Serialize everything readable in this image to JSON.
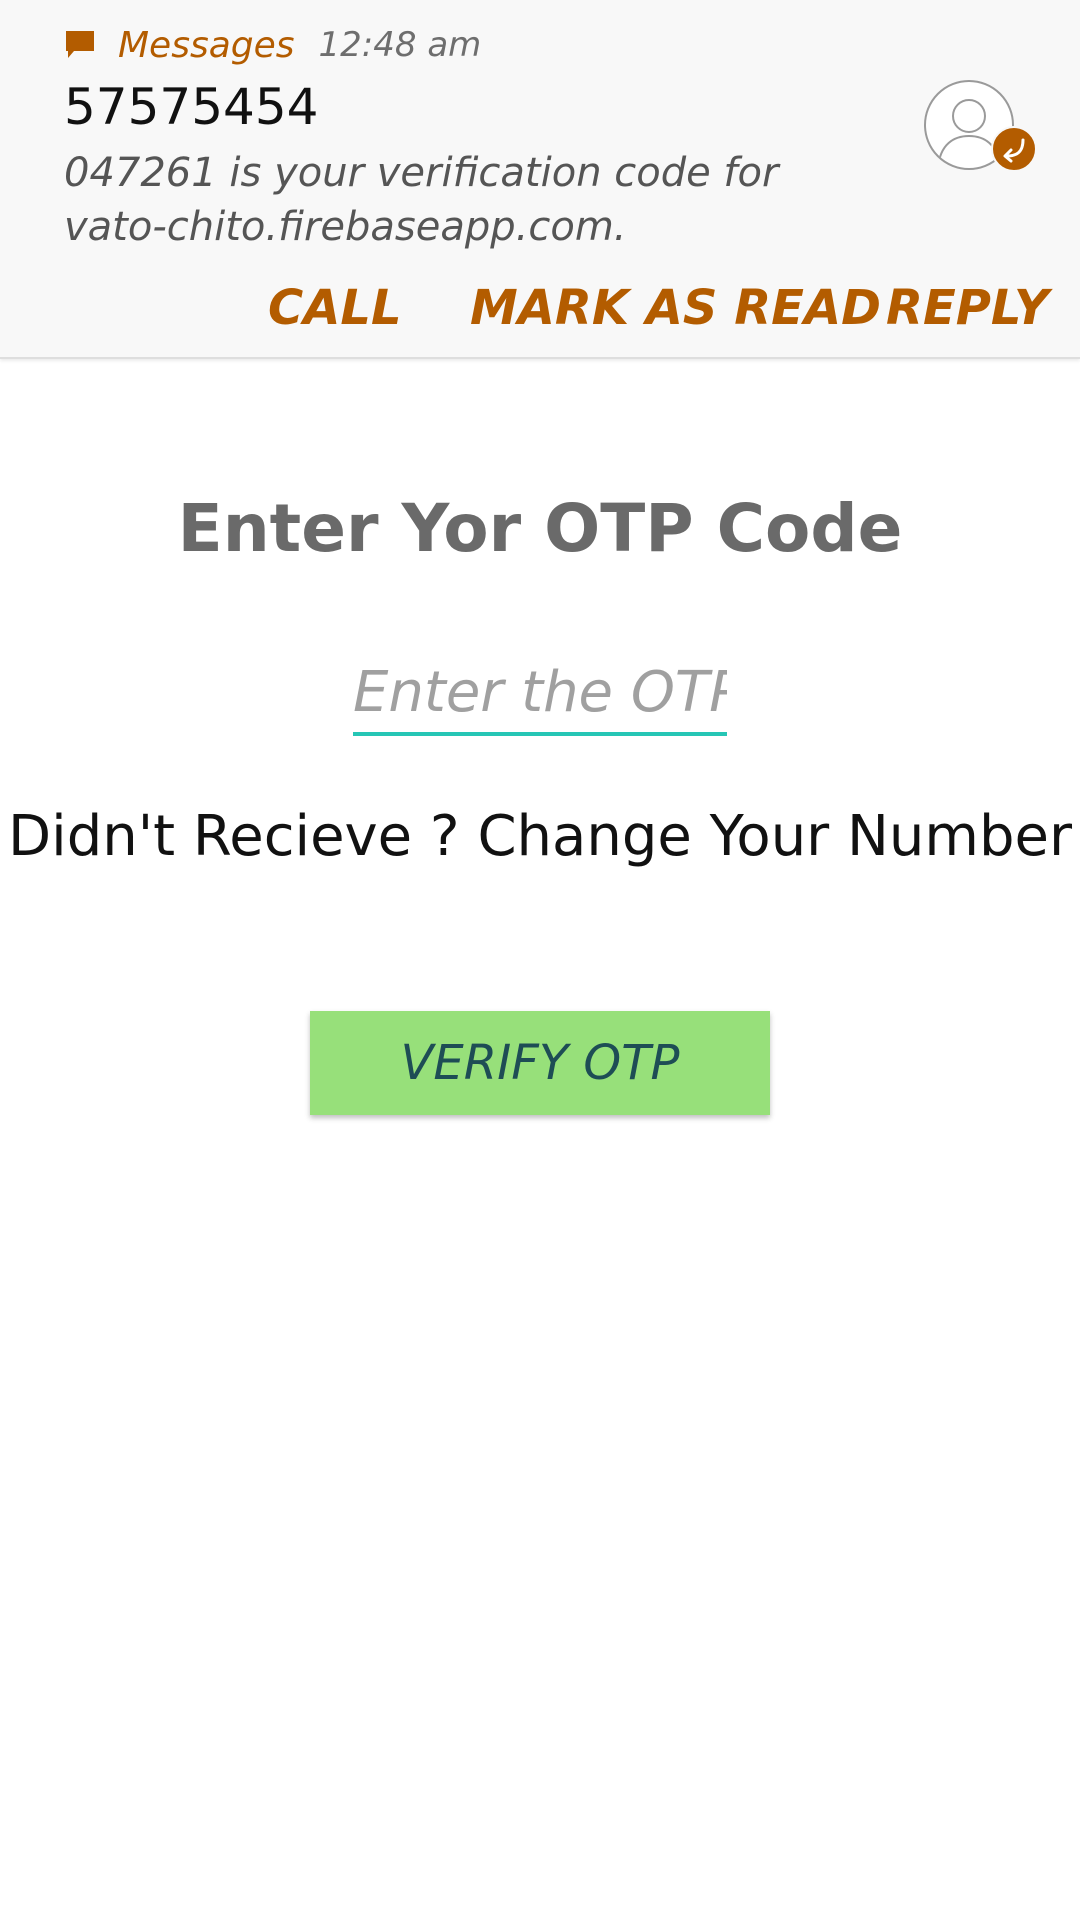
{
  "notification": {
    "app_icon": "message-bubble-icon",
    "app_name": "Messages",
    "time": "12:48 am",
    "sender": "57575454",
    "body": "047261 is your verification code for vato-chito.firebaseapp.com.",
    "avatar_icon": "contact-avatar-icon",
    "badge_icon": "reply-arrow-icon",
    "actions": {
      "call": "CALL",
      "mark_as_read": "MARK AS READ",
      "reply": "REPLY"
    },
    "accent_color": "#b35c00"
  },
  "main": {
    "title": "Enter Yor OTP Code",
    "otp_input": {
      "value": "",
      "placeholder": "Enter the OTP"
    },
    "change_number_link": "Didn't Recieve ? Change Your Number",
    "verify_button": "VERIFY OTP",
    "input_underline_color": "#26c6b5",
    "button_color": "#97e07a"
  }
}
